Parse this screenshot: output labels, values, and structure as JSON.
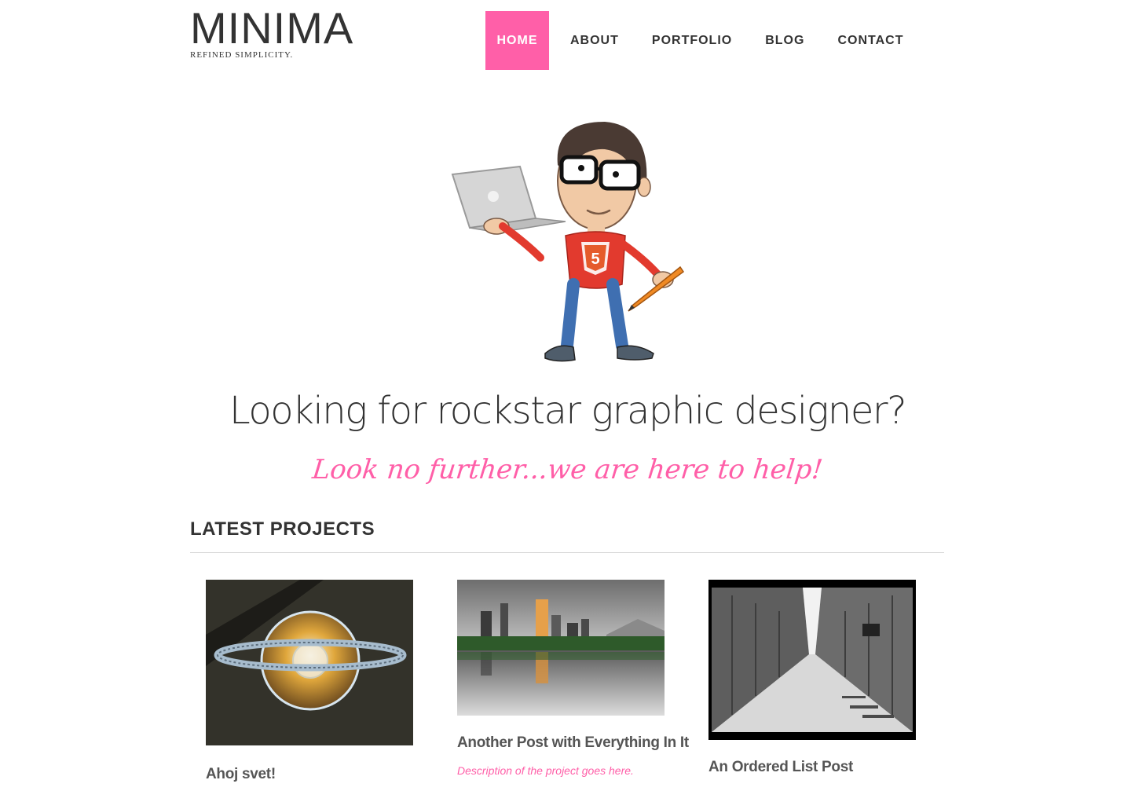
{
  "site": {
    "title": "MINIMA",
    "tagline": "REFINED SIMPLICITY."
  },
  "nav": {
    "home": "HOME",
    "about": "ABOUT",
    "portfolio": "PORTFOLIO",
    "blog": "BLOG",
    "contact": "CONTACT",
    "active": "home"
  },
  "hero": {
    "illustration_icon": "designer-mascot-illustration",
    "heading": "Looking for rockstar graphic designer?",
    "subheading": "Look no further...we are here to help!"
  },
  "projects": {
    "section_title": "LATEST PROJECTS",
    "items": [
      {
        "title": "Ahoj svet!",
        "image_icon": "glass-orb-photo"
      },
      {
        "title": "Another Post with Everything In It",
        "description": "Description of the project goes here.",
        "image_icon": "city-lake-photo"
      },
      {
        "title": "An Ordered List Post",
        "image_icon": "arcade-gallery-photo"
      }
    ]
  },
  "colors": {
    "accent": "#ff5fa8",
    "text": "#333333"
  }
}
